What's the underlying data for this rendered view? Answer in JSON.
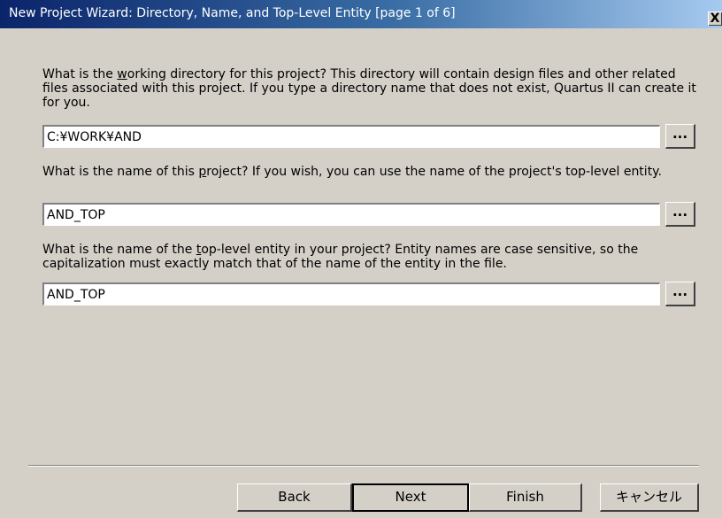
{
  "window": {
    "title": "New Project Wizard: Directory, Name, and Top-Level Entity [page 1 of 6]",
    "close_label": "X"
  },
  "directory": {
    "question_pre": "What is the ",
    "question_key": "w",
    "question_post": "orking directory for this project?  This directory will contain design files and other related files associated with this project.  If you type a directory name that does not exist, Quartus II can create it for you.",
    "value": "C:¥WORK¥AND",
    "browse_label": "..."
  },
  "project_name": {
    "question_pre": "What is the name of this ",
    "question_key": "p",
    "question_post": "roject?  If you wish, you can use the name of the project's top-level entity.",
    "value": "AND_TOP",
    "browse_label": "..."
  },
  "top_entity": {
    "question_pre": "What is the name of the ",
    "question_key": "t",
    "question_post": "op-level entity in your project?  Entity names are case sensitive, so the capitalization must exactly match that of the name of the entity in the file.",
    "value": "AND_TOP",
    "browse_label": "..."
  },
  "buttons": {
    "back": "Back",
    "next": "Next",
    "finish": "Finish",
    "cancel": "キャンセル"
  }
}
